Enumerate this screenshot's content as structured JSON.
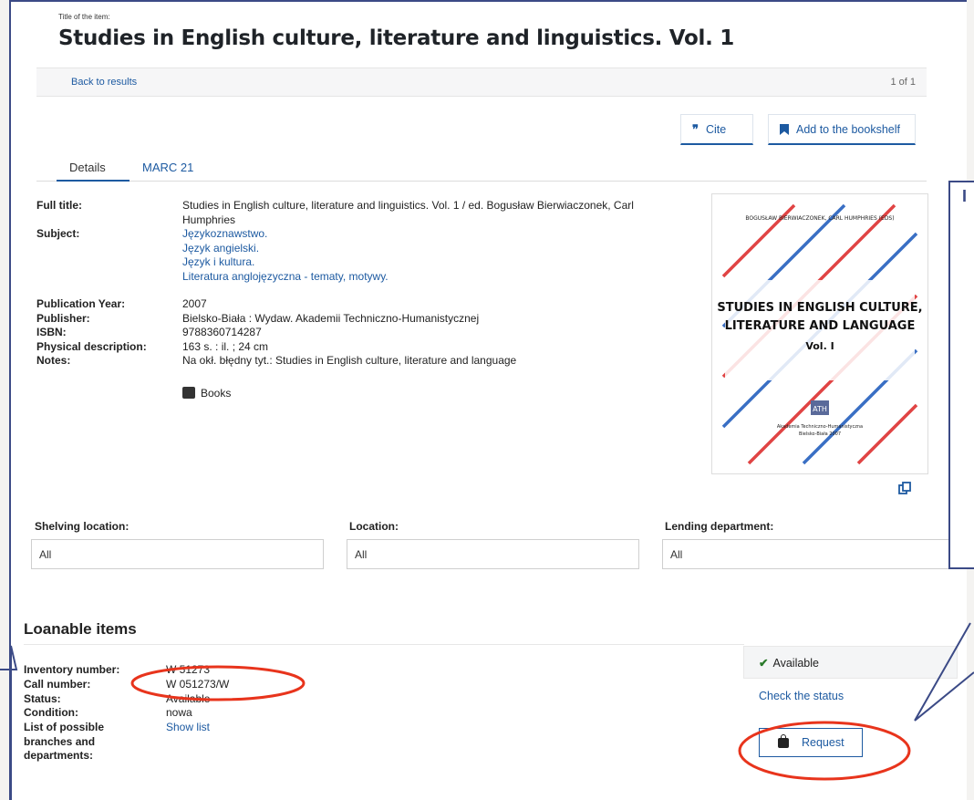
{
  "header": {
    "caption": "Title of the item:",
    "title": "Studies in English culture, literature and linguistics. Vol. 1"
  },
  "nav": {
    "back": "Back to results",
    "pager": "1 of 1"
  },
  "actions": {
    "cite": "Cite",
    "cite_icon": "quote-icon",
    "bookshelf": "Add to the bookshelf",
    "bookshelf_icon": "bookmark-icon"
  },
  "tabs": [
    {
      "label": "Details",
      "active": true
    },
    {
      "label": "MARC 21",
      "active": false
    }
  ],
  "details": {
    "full_title_label": "Full title:",
    "full_title": "Studies in English culture, literature and linguistics. Vol. 1 / ed. Bogusław Bierwiaczonek, Carl Humphries",
    "subject_label": "Subject:",
    "subjects": [
      "Językoznawstwo.",
      "Język angielski.",
      "Język i kultura.",
      "Literatura anglojęzyczna - tematy, motywy."
    ],
    "year_label": "Publication Year:",
    "year": "2007",
    "publisher_label": "Publisher:",
    "publisher": "Bielsko-Biała : Wydaw. Akademii Techniczno-Humanistycznej",
    "isbn_label": "ISBN:",
    "isbn": "9788360714287",
    "physical_label": "Physical description:",
    "physical": "163 s. : il. ; 24 cm",
    "notes_label": "Notes:",
    "notes": "Na okł. błędny tyt.: Studies in English culture, literature and language",
    "type": "Books",
    "type_icon": "book-icon"
  },
  "cover": {
    "top_text": "BOGUSŁAW BIERWIACZONEK, CARL HUMPHRIES (EDS)",
    "title_line1": "STUDIES IN ENGLISH CULTURE,",
    "title_line2": "LITERATURE AND LANGUAGE",
    "volume": "Vol. I",
    "logo": "ATH",
    "publisher_line1": "Akademia Techniczno-Humanistyczna",
    "publisher_line2": "Bielsko-Biała 2007"
  },
  "filters": [
    {
      "label": "Shelving location:",
      "value": "All"
    },
    {
      "label": "Location:",
      "value": "All"
    },
    {
      "label": "Lending department:",
      "value": "All"
    }
  ],
  "loanable": {
    "title": "Loanable items",
    "inventory_label": "Inventory number:",
    "inventory": "W 51273",
    "call_label": "Call number:",
    "call": "W 051273/W",
    "status_label": "Status:",
    "status": "Available",
    "condition_label": "Condition:",
    "condition": "nowa",
    "branches_label_1": "List of possible",
    "branches_label_2": "branches and",
    "branches_label_3": "departments:",
    "show_list": "Show list",
    "available": "Available",
    "check_status": "Check the status",
    "request": "Request"
  },
  "annotation": {
    "letter": "I",
    "color": "#3b4a86",
    "highlight_color": "#e8341c"
  }
}
